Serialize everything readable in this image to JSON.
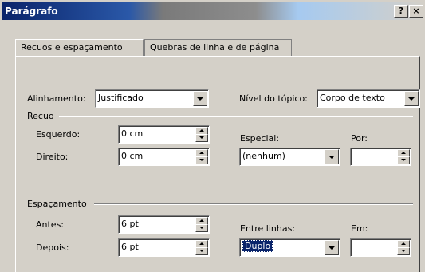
{
  "window": {
    "title": "Parágrafo",
    "help_btn": "?",
    "close_btn": "×"
  },
  "tabs": [
    {
      "label": "Recuos e espaçamento",
      "mnemonic": "R"
    },
    {
      "label": "Quebras de linha e de página",
      "mnemonic": "Q"
    }
  ],
  "alinhamento": {
    "label": "Alinhamento:",
    "value": "Justificado"
  },
  "nivel": {
    "label": "Nível do tópico:",
    "value": "Corpo de texto"
  },
  "recuo": {
    "section": "Recuo",
    "esquerdo_label": "Esquerdo:",
    "esquerdo_value": "0 cm",
    "direito_label": "Direito:",
    "direito_value": "0 cm",
    "especial_label": "Especial:",
    "especial_value": "(nenhum)",
    "por_label": "Por:",
    "por_value": ""
  },
  "espacamento": {
    "section": "Espaçamento",
    "antes_label": "Antes:",
    "antes_value": "6 pt",
    "depois_label": "Depois:",
    "depois_value": "6 pt",
    "entre_label": "Entre linhas:",
    "entre_value": "Duplo",
    "em_label": "Em:",
    "em_value": ""
  }
}
